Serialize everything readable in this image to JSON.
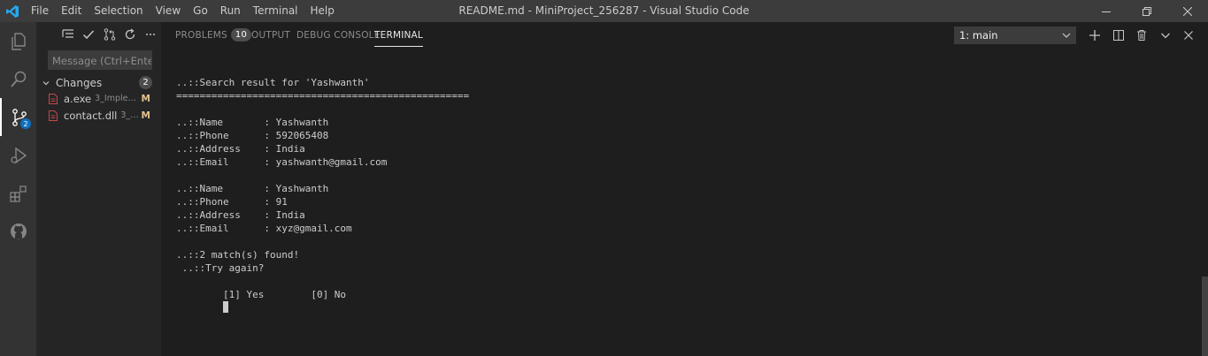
{
  "menu": [
    "File",
    "Edit",
    "Selection",
    "View",
    "Go",
    "Run",
    "Terminal",
    "Help"
  ],
  "window_title": "README.md - MiniProject_256287 - Visual Studio Code",
  "activity_bar": {
    "scm_badge": "2"
  },
  "sidebar": {
    "message_placeholder": "Message (Ctrl+Enter ...",
    "changes_label": "Changes",
    "changes_count": "2",
    "files": [
      {
        "name": "a.exe",
        "path": "3_Impleme...",
        "status": "M"
      },
      {
        "name": "contact.dll",
        "path": "3_Im...",
        "status": "M"
      }
    ]
  },
  "panel": {
    "tabs": [
      {
        "label": "PROBLEMS",
        "badge": "10"
      },
      {
        "label": "OUTPUT"
      },
      {
        "label": "DEBUG CONSOLE"
      },
      {
        "label": "TERMINAL"
      }
    ],
    "terminal_select": "1: main"
  },
  "terminal": {
    "lines": [
      "..::Search result for 'Yashwanth'",
      "==================================================",
      "",
      "..::Name       : Yashwanth",
      "..::Phone      : 592065408",
      "..::Address    : India",
      "..::Email      : yashwanth@gmail.com",
      "",
      "..::Name       : Yashwanth",
      "..::Phone      : 91",
      "..::Address    : India",
      "..::Email      : xyz@gmail.com",
      "",
      "..::2 match(s) found!",
      " ..::Try again?",
      "",
      "        [1] Yes        [0] No"
    ]
  },
  "colors": {
    "accent": "#0e70c0",
    "modified": "#e2c08d",
    "background": "#1e1e1e"
  }
}
